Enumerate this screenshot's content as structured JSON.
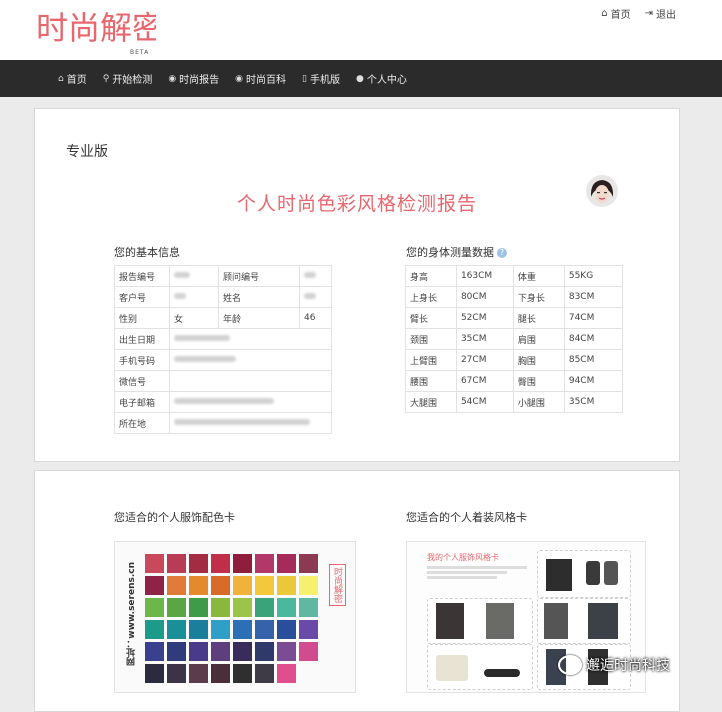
{
  "header": {
    "logo_text": "时尚解密",
    "logo_badge": "BETA",
    "links": [
      {
        "icon": "home-icon",
        "label": "首页"
      },
      {
        "icon": "logout-icon",
        "label": "退出"
      }
    ]
  },
  "nav": {
    "items": [
      {
        "icon": "home-icon",
        "glyph": "⌂",
        "label": "首页"
      },
      {
        "icon": "search-icon",
        "glyph": "⚲",
        "label": "开始检测"
      },
      {
        "icon": "report-icon",
        "glyph": "◉",
        "label": "时尚报告"
      },
      {
        "icon": "encyclopedia-icon",
        "glyph": "◉",
        "label": "时尚百科"
      },
      {
        "icon": "mobile-icon",
        "glyph": "▯",
        "label": "手机版"
      },
      {
        "icon": "user-icon",
        "glyph": "●",
        "label": "个人中心"
      }
    ]
  },
  "report": {
    "edition": "专业版",
    "title": "个人时尚色彩风格检测报告"
  },
  "basic_info": {
    "heading": "您的基本信息",
    "labels": {
      "report_no": "报告编号",
      "advisor_no": "顾问编号",
      "customer_no": "客户号",
      "name": "姓名",
      "gender": "性别",
      "gender_value": "女",
      "age": "年龄",
      "age_value": "46",
      "birth": "出生日期",
      "phone": "手机号码",
      "wechat": "微信号",
      "email": "电子邮箱",
      "location": "所在地"
    }
  },
  "body": {
    "heading": "您的身体测量数据",
    "rows": [
      [
        "身高",
        "163CM",
        "体重",
        "55KG"
      ],
      [
        "上身长",
        "80CM",
        "下身长",
        "83CM"
      ],
      [
        "臂长",
        "52CM",
        "腿长",
        "74CM"
      ],
      [
        "颈围",
        "35CM",
        "肩围",
        "84CM"
      ],
      [
        "上臂围",
        "27CM",
        "胸围",
        "85CM"
      ],
      [
        "腰围",
        "67CM",
        "臀围",
        "94CM"
      ],
      [
        "大腿围",
        "54CM",
        "小腿围",
        "35CM"
      ]
    ]
  },
  "color_card": {
    "heading": "您适合的个人服饰配色卡",
    "side_text": "网址：www.serens.cn",
    "stamp": "时尚解密",
    "swatches": [
      "#c9485a",
      "#b83c55",
      "#a32c43",
      "#c12e4a",
      "#8f1e3c",
      "#b2386a",
      "#a42b5a",
      "#8c3a52",
      "#8f2347",
      "#e07b3a",
      "#e4892d",
      "#d86a2a",
      "#f0b23a",
      "#f3c83d",
      "#e9c93a",
      "#f5f06e",
      "#6db64a",
      "#5aa544",
      "#3f9a4a",
      "#8ab83f",
      "#9cc44a",
      "#3aa37a",
      "#4cb89b",
      "#5eb8a2",
      "#1d9b8a",
      "#1a8f98",
      "#1b7f9b",
      "#2f9fc7",
      "#2d6fb4",
      "#3562a8",
      "#2a4f9a",
      "#6a4aa8",
      "#3a3f8e",
      "#2f3b7a",
      "#4a3a8a",
      "#5c3f7c",
      "#3a2c5a",
      "#2f3a6a",
      "#7a4c94",
      "#d14b8f",
      "#2b2b3f",
      "#3a3446",
      "#5a3c4c",
      "#4a2e3a",
      "#2f2f2f",
      "#3e3a46",
      "#e04e8e",
      ""
    ]
  },
  "style_card": {
    "heading": "您适合的个人着装风格卡",
    "card_title": "我的个人服饰风格卡"
  },
  "watermark": {
    "text": "邂逅时尚科技"
  }
}
